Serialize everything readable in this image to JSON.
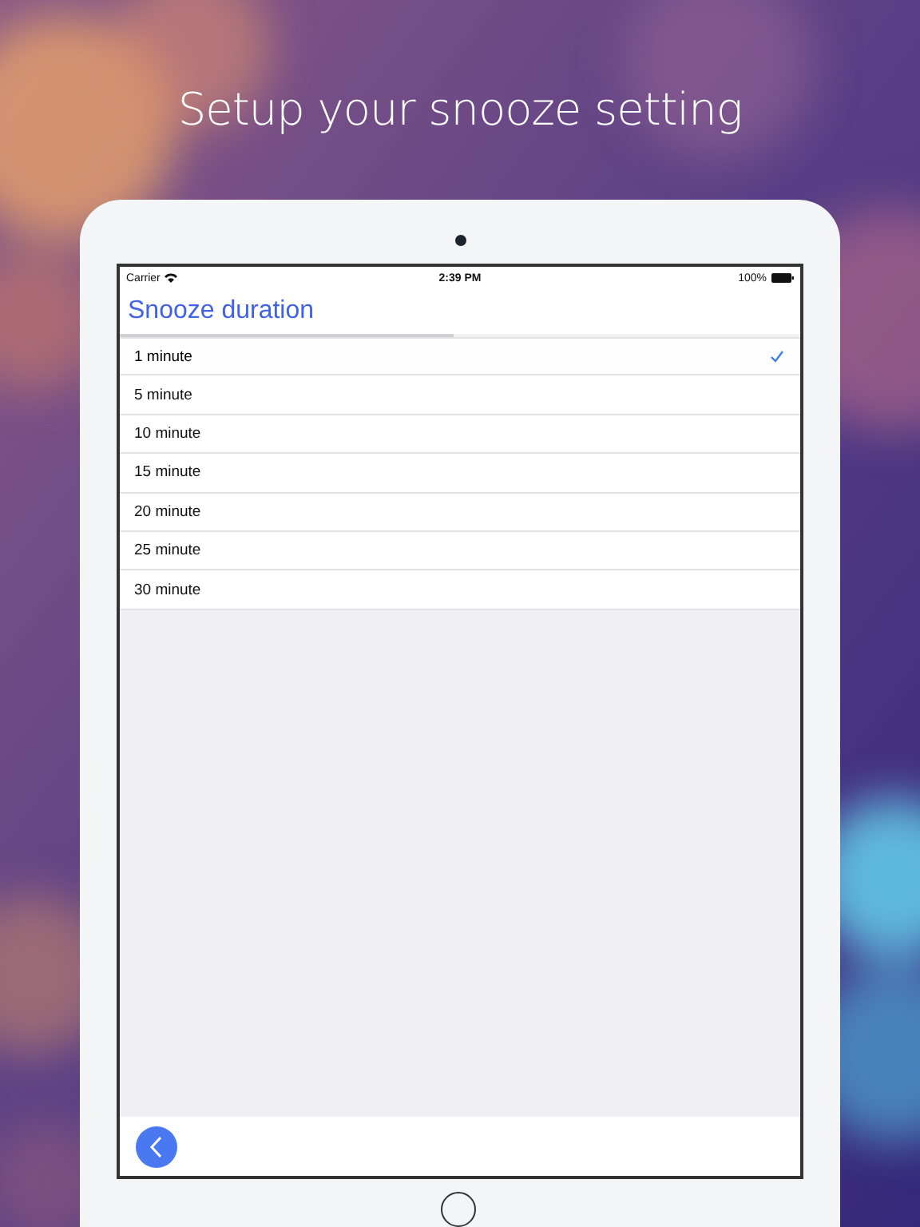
{
  "headline": "Setup your snooze setting",
  "status_bar": {
    "carrier": "Carrier",
    "time": "2:39 PM",
    "battery": "100%"
  },
  "nav": {
    "title": "Snooze duration"
  },
  "progress": {
    "level": 0.49
  },
  "options": [
    {
      "label": "1 minute",
      "selected": true
    },
    {
      "label": "5 minute",
      "selected": false
    },
    {
      "label": "10 minute",
      "selected": false
    },
    {
      "label": "15 minute",
      "selected": false
    },
    {
      "label": "20 minute",
      "selected": false
    },
    {
      "label": "25 minute",
      "selected": false
    },
    {
      "label": "30 minute",
      "selected": false
    }
  ]
}
